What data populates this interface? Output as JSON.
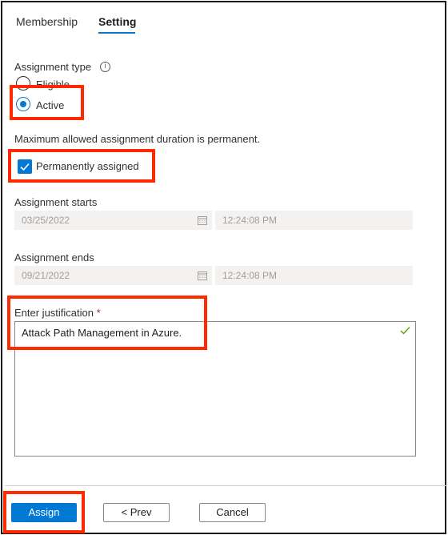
{
  "tabs": {
    "membership": "Membership",
    "setting": "Setting"
  },
  "assignment_type": {
    "label": "Assignment type",
    "info_icon": "i",
    "options": {
      "eligible": "Eligible",
      "active": "Active"
    },
    "selected": "Active"
  },
  "duration_note": "Maximum allowed assignment duration is permanent.",
  "permanent_checkbox": {
    "label": "Permanently assigned",
    "checked": true
  },
  "assignment_starts": {
    "label": "Assignment starts",
    "date": "03/25/2022",
    "time": "12:24:08 PM"
  },
  "assignment_ends": {
    "label": "Assignment ends",
    "date": "09/21/2022",
    "time": "12:24:08 PM"
  },
  "justification": {
    "label": "Enter justification",
    "required_marker": "*",
    "value": "Attack Path Management in Azure."
  },
  "buttons": {
    "assign": "Assign",
    "prev": "< Prev",
    "cancel": "Cancel"
  },
  "colors": {
    "accent": "#0078d4",
    "highlight": "#ff2a00",
    "valid_check": "#57a300",
    "required": "#a4262c"
  }
}
